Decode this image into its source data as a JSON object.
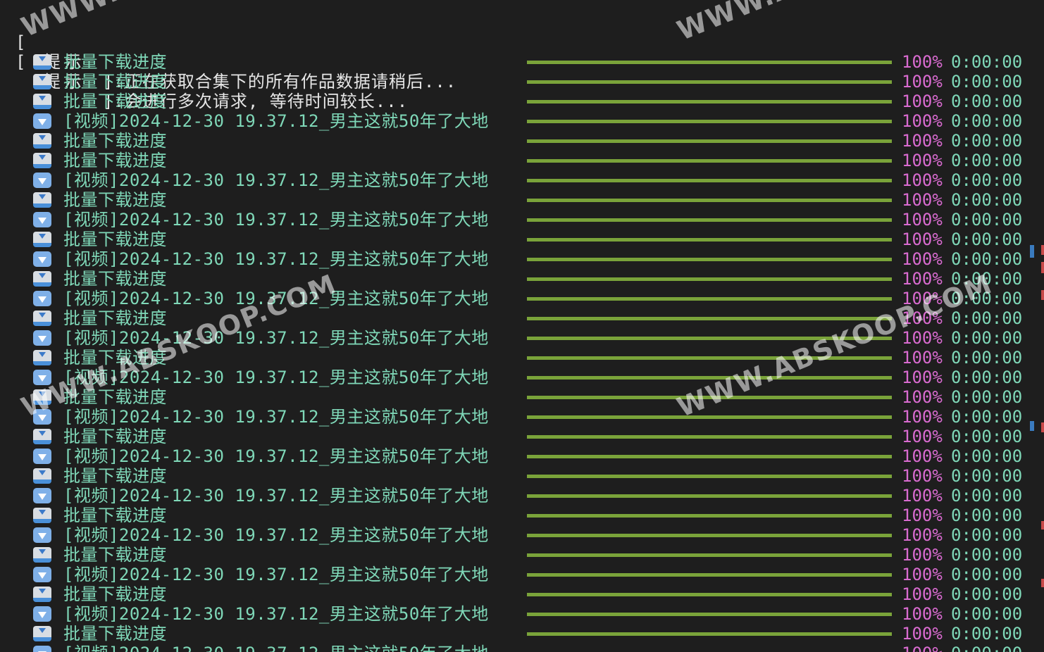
{
  "hints": [
    {
      "bracket_open": "[",
      "word": "提示",
      "rest": "]:正在获取合集下的所有作品数据请稍后..."
    },
    {
      "bracket_open": "[",
      "word": "提示",
      "rest": "]:会进行多次请求, 等待时间较长..."
    }
  ],
  "labels": {
    "batch": "批量下载进度",
    "video": "[视频]2024-12-30 19.37.12_男主这就50年了大地"
  },
  "icons": {
    "batch": "inbox-tray-icon",
    "video": "down-arrow-icon"
  },
  "progress": {
    "percent_text": "100%",
    "time_text": "0:00:00",
    "fraction": 1.0
  },
  "rows": [
    {
      "type": "batch"
    },
    {
      "type": "batch"
    },
    {
      "type": "batch"
    },
    {
      "type": "video"
    },
    {
      "type": "batch"
    },
    {
      "type": "batch"
    },
    {
      "type": "video"
    },
    {
      "type": "batch"
    },
    {
      "type": "video"
    },
    {
      "type": "batch"
    },
    {
      "type": "video"
    },
    {
      "type": "batch"
    },
    {
      "type": "video"
    },
    {
      "type": "batch"
    },
    {
      "type": "video"
    },
    {
      "type": "batch"
    },
    {
      "type": "video"
    },
    {
      "type": "batch"
    },
    {
      "type": "video"
    },
    {
      "type": "batch"
    },
    {
      "type": "video"
    },
    {
      "type": "batch"
    },
    {
      "type": "video"
    },
    {
      "type": "batch"
    },
    {
      "type": "video"
    },
    {
      "type": "batch"
    },
    {
      "type": "video"
    },
    {
      "type": "batch"
    },
    {
      "type": "video"
    },
    {
      "type": "batch"
    },
    {
      "type": "video"
    }
  ],
  "watermark": "WWW.ABSKOOP.COM",
  "colors": {
    "background": "#1e1e1e",
    "label": "#7fd8b8",
    "bar": "#7aa33a",
    "percent": "#d96bd0",
    "time": "#7fd8b8",
    "scroll_blue": "#3a7bbf",
    "scroll_red": "#c84a4a"
  }
}
